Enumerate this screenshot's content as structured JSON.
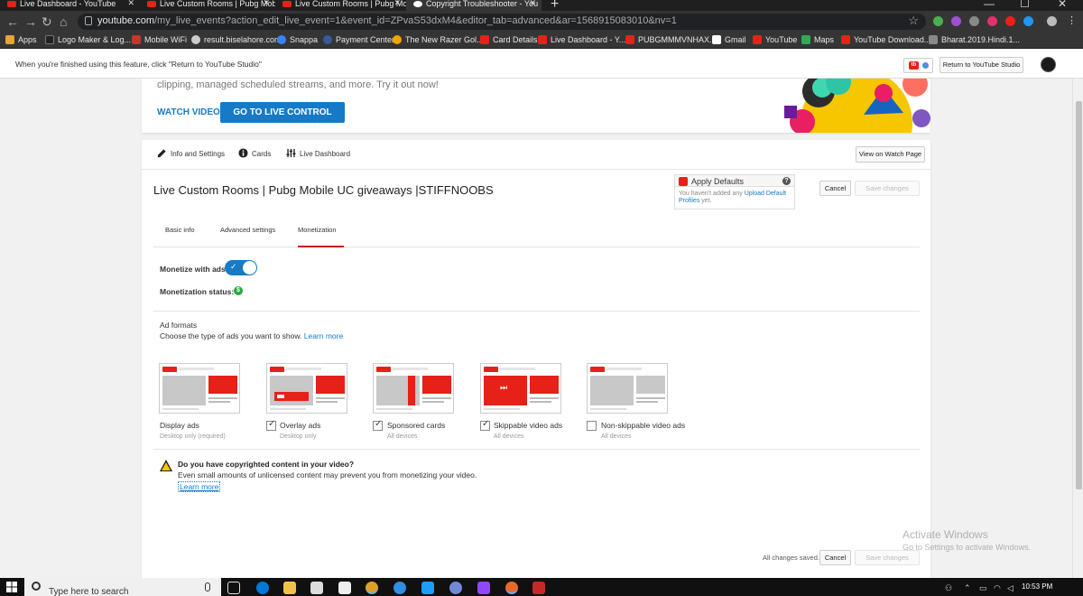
{
  "browser": {
    "tabs": [
      {
        "title": "Live Dashboard - YouTube"
      },
      {
        "title": "Live Custom Rooms | Pubg Mobi"
      },
      {
        "title": "Live Custom Rooms | Pubg Mobi"
      },
      {
        "title": "Copyright Troubleshooter - You"
      }
    ],
    "url_host": "youtube.com",
    "url_path": "/my_live_events?action_edit_live_event=1&event_id=ZPvaS53dxM4&editor_tab=advanced&ar=1568915083010&nv=1",
    "bookmarks": [
      {
        "label": "Apps",
        "color": "#e8a33a"
      },
      {
        "label": "Logo Maker & Log...",
        "color": "#222222"
      },
      {
        "label": "Mobile WiFi",
        "color": "#c0392b"
      },
      {
        "label": "result.biselahore.com",
        "color": "#cccccc"
      },
      {
        "label": "Snappa",
        "color": "#3b82f6"
      },
      {
        "label": "Payment Center",
        "color": "#3b5998"
      },
      {
        "label": "The New Razer Gol...",
        "color": "#f0a500"
      },
      {
        "label": "Card Details",
        "color": "#e62117"
      },
      {
        "label": "Live Dashboard - Y...",
        "color": "#e62117"
      },
      {
        "label": "PUBGMMMVNHAX...",
        "color": "#e62117"
      },
      {
        "label": "Gmail",
        "color": "#ffffff"
      },
      {
        "label": "YouTube",
        "color": "#e62117"
      },
      {
        "label": "Maps",
        "color": "#34a853"
      },
      {
        "label": "YouTube Download...",
        "color": "#e62117"
      },
      {
        "label": "Bharat.2019.Hindi.1...",
        "color": "#888888"
      }
    ]
  },
  "notice": {
    "message": "When you're finished using this feature, click \"Return to YouTube Studio\"",
    "return_label": "Return to YouTube Studio",
    "tb_label": "tb"
  },
  "banner": {
    "text": "clipping, managed scheduled streams, and more. Try it out now!",
    "watch_label": "WATCH VIDEO",
    "golive_label": "GO TO LIVE CONTROL ROOM"
  },
  "toptabs": {
    "info": "Info and Settings",
    "cards": "Cards",
    "dashboard": "Live Dashboard",
    "view_watch": "View on Watch Page"
  },
  "video": {
    "title": "Live Custom Rooms | Pubg Mobile UC giveaways |STIFFNOOBS"
  },
  "defaults": {
    "title": "Apply Defaults",
    "help": "?",
    "body_pre": "You haven't added any",
    "body_link": "Upload Default Profiles",
    "body_post": "yet."
  },
  "actions": {
    "cancel": "Cancel",
    "save": "Save changes",
    "saved_status": "All changes saved."
  },
  "subtabs": {
    "basic": "Basic info",
    "advanced": "Advanced settings",
    "monetization": "Monetization"
  },
  "monetize": {
    "label": "Monetize with ads",
    "enabled": true,
    "status_label": "Monetization status:",
    "status_symbol": "$"
  },
  "ad_formats": {
    "title": "Ad formats",
    "desc": "Choose the type of ads you want to show.",
    "learn_more": "Learn more",
    "items": [
      {
        "label": "Display ads",
        "sub": "Desktop only (required)",
        "checked": null
      },
      {
        "label": "Overlay ads",
        "sub": "Desktop only",
        "checked": true
      },
      {
        "label": "Sponsored cards",
        "sub": "All devices",
        "checked": true
      },
      {
        "label": "Skippable video ads",
        "sub": "All devices",
        "checked": true
      },
      {
        "label": "Non-skippable video ads",
        "sub": "All devices",
        "checked": false
      }
    ]
  },
  "copyright": {
    "title": "Do you have copyrighted content in your video?",
    "text": "Even small amounts of unlicensed content may prevent you from monetizing your video.",
    "link": "Learn more"
  },
  "watermark": {
    "line1": "Activate Windows",
    "line2": "Go to Settings to activate Windows."
  },
  "taskbar": {
    "search_placeholder": "Type here to search",
    "time": "10:53 PM"
  },
  "colors": {
    "accent": "#167ac6",
    "youtube_red": "#e62117",
    "active_tab": "#cc181e"
  }
}
